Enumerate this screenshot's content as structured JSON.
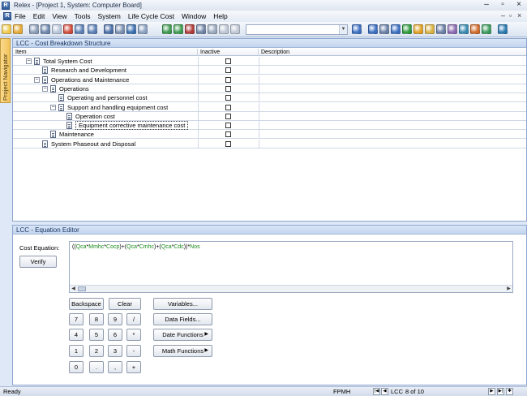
{
  "window": {
    "title": "Relex - [Project 1, System: Computer Board]",
    "app_icon_letter": "R"
  },
  "menu": {
    "items": [
      "File",
      "Edit",
      "View",
      "Tools",
      "System",
      "Life Cycle Cost",
      "Window",
      "Help"
    ]
  },
  "navigator": {
    "label": "Project Navigator"
  },
  "cbs_panel": {
    "title": "LCC - Cost Breakdown Structure",
    "columns": [
      "Item",
      "Inactive",
      "Description"
    ],
    "rows": [
      {
        "label": "Total System Cost",
        "level": 0,
        "expander": "−",
        "selected": false
      },
      {
        "label": "Research and Development",
        "level": 1,
        "expander": "",
        "selected": false
      },
      {
        "label": "Operations and Maintenance",
        "level": 1,
        "expander": "−",
        "selected": false
      },
      {
        "label": "Operations",
        "level": 2,
        "expander": "−",
        "selected": false
      },
      {
        "label": "Operating and personnel cost",
        "level": 3,
        "expander": "",
        "selected": false
      },
      {
        "label": "Support and handling equipment cost",
        "level": 3,
        "expander": "−",
        "selected": false
      },
      {
        "label": "Operation cost",
        "level": 4,
        "expander": "",
        "selected": false
      },
      {
        "label": "Equipment corrective maintenance cost",
        "level": 4,
        "expander": "",
        "selected": true
      },
      {
        "label": "Maintenance",
        "level": 2,
        "expander": "",
        "selected": false
      },
      {
        "label": "System Phaseout and Disposal",
        "level": 1,
        "expander": "",
        "selected": false
      }
    ]
  },
  "equation_panel": {
    "title": "LCC - Equation Editor",
    "cost_equation_label": "Cost Equation:",
    "verify_label": "Verify",
    "equation_parts": [
      {
        "t": "((",
        "g": false
      },
      {
        "t": "Qca",
        "g": true
      },
      {
        "t": "*",
        "g": false
      },
      {
        "t": "Mmhc",
        "g": true
      },
      {
        "t": "*",
        "g": false
      },
      {
        "t": "Cocp",
        "g": true
      },
      {
        "t": ")+(",
        "g": false
      },
      {
        "t": "Qca",
        "g": true
      },
      {
        "t": "*",
        "g": false
      },
      {
        "t": "Cmhc",
        "g": true
      },
      {
        "t": ")+(",
        "g": false
      },
      {
        "t": "Qca",
        "g": true
      },
      {
        "t": "*",
        "g": false
      },
      {
        "t": "Cdc",
        "g": true
      },
      {
        "t": "))*",
        "g": false
      },
      {
        "t": "Nos",
        "g": true
      }
    ],
    "keypad": {
      "backspace": "Backspace",
      "clear": "Clear",
      "keys": [
        "7",
        "8",
        "9",
        "/",
        "4",
        "5",
        "6",
        "*",
        "1",
        "2",
        "3",
        "-",
        "0",
        ".",
        ",",
        "+"
      ]
    },
    "side_buttons": {
      "variables": "Variables...",
      "data_fields": "Data Fields...",
      "date_functions": "Date Functions",
      "math_functions": "Math Functions"
    }
  },
  "statusbar": {
    "left": "Ready",
    "mode": "FPMH",
    "module": "LCC",
    "record": "8 of 10"
  },
  "toolbar_icons": [
    "new-icon",
    "open-icon",
    "cut-icon",
    "copy-icon",
    "paste-icon",
    "delete-icon",
    "undo-icon",
    "redo-icon",
    "print-icon",
    "preview-icon",
    "find-icon",
    "spell-icon",
    "export-icon",
    "import-icon",
    "calculator-icon",
    "table-icon",
    "globe-icon",
    "filter-icon",
    "chart-icon",
    "help-icon",
    "nav-icon",
    "structure-icon",
    "tree-icon",
    "flag-icon",
    "pie-icon",
    "lock-icon",
    "wrench-icon",
    "gear-icon",
    "cube-icon",
    "puzzle-icon",
    "person-icon",
    "equation-icon"
  ]
}
